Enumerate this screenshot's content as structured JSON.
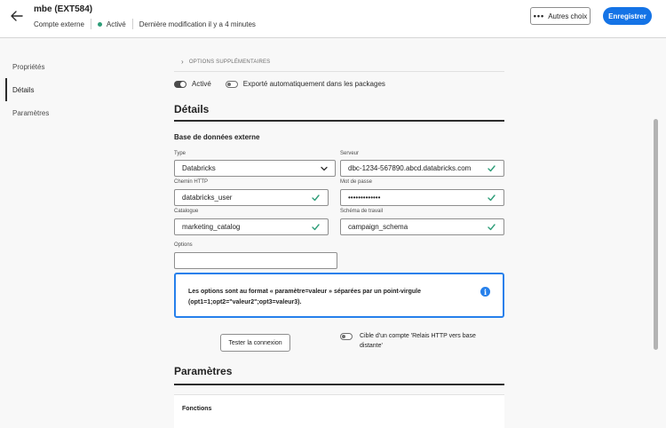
{
  "header": {
    "title": "mbe (EXT584)",
    "account_type": "Compte externe",
    "status": "Activé",
    "last_modified": "Dernière modification il y a 4 minutes",
    "more_label": "Autres choix",
    "save_label": "Enregistrer",
    "status_color": "#2d9d78",
    "accent_color": "#1473e6"
  },
  "sidebar": {
    "items": [
      {
        "label": "Propriétés",
        "icon": null
      },
      {
        "label": "Détails",
        "active": true
      },
      {
        "label": "Paramètres"
      }
    ]
  },
  "main": {
    "additional_options": "OPTIONS SUPPLÉMENTAIRES",
    "toggle_active_label": "Activé",
    "toggle_active_on": true,
    "toggle_export_label": "Exporté automatiquement dans les packages",
    "toggle_export_on": false,
    "details_title": "Détails",
    "db_subtitle": "Base de données externe",
    "fields": {
      "type_label": "Type",
      "type_value": "Databricks",
      "server_label": "Serveur",
      "server_value": "dbc-1234-567890.abcd.databricks.com",
      "http_path_label": "Chemin HTTP",
      "http_path_value": "databricks_user",
      "password_label": "Mot de passe",
      "password_value": "•••••••••••••",
      "catalog_label": "Catalogue",
      "catalog_value": "marketing_catalog",
      "schema_label": "Schéma de travail",
      "schema_value": "campaign_schema",
      "options_label": "Options",
      "options_value": ""
    },
    "info_text": "Les options sont au format « paramètre=valeur » séparées par un point-virgule (opt1=1;opt2=\"valeur2\";opt3=valeur3).",
    "test_button": "Tester la connexion",
    "relay_label": "Cible d'un compte 'Relais HTTP vers base distante'",
    "relay_on": false,
    "params_title": "Paramètres",
    "functions_label": "Fonctions"
  },
  "icons": {
    "back": "arrow-left-icon",
    "more": "ellipsis-icon",
    "chevron": "chevron-right-icon",
    "check": "checkmark-icon",
    "dropdown": "chevron-down-icon",
    "info": "info-icon"
  }
}
